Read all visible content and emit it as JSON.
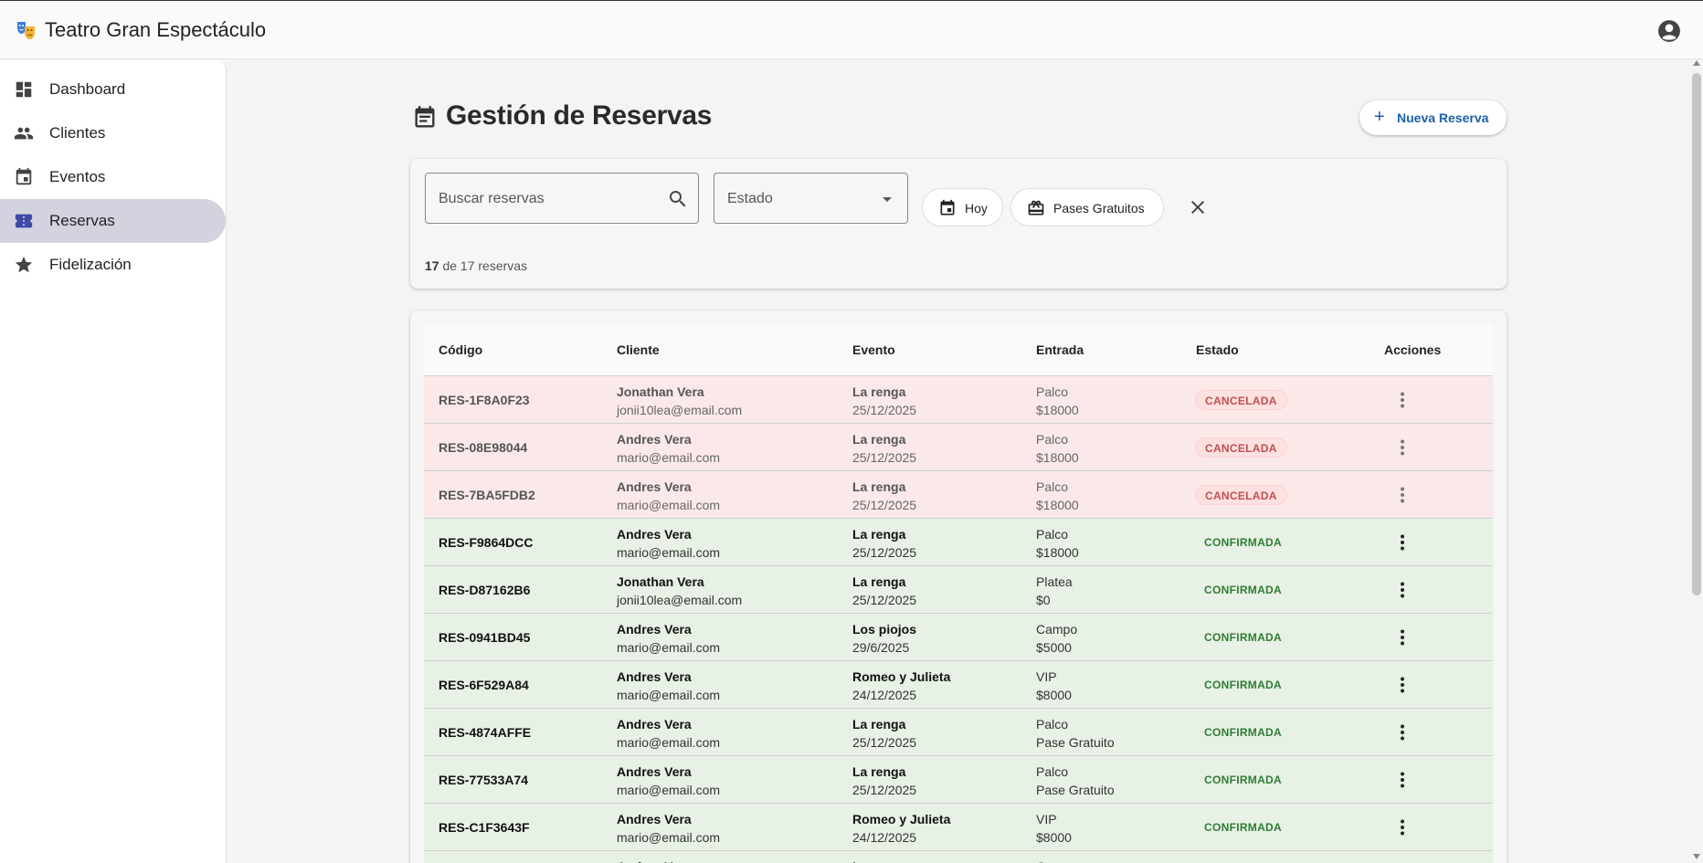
{
  "app": {
    "title": "Teatro Gran Espectáculo"
  },
  "sidebar": {
    "items": [
      {
        "label": "Dashboard",
        "icon": "dashboard-icon",
        "active": false
      },
      {
        "label": "Clientes",
        "icon": "people-icon",
        "active": false
      },
      {
        "label": "Eventos",
        "icon": "calendar-icon",
        "active": false
      },
      {
        "label": "Reservas",
        "icon": "ticket-icon",
        "active": true
      },
      {
        "label": "Fidelización",
        "icon": "star-icon",
        "active": false
      }
    ]
  },
  "page": {
    "title": "Gestión de Reservas",
    "new_button": "Nueva Reserva"
  },
  "filters": {
    "search_placeholder": "Buscar reservas",
    "status_label": "Estado",
    "chip_today": "Hoy",
    "chip_free": "Pases Gratuitos",
    "count_shown": "17",
    "count_rest": "de 17 reservas"
  },
  "table": {
    "headers": [
      "Código",
      "Cliente",
      "Evento",
      "Entrada",
      "Estado",
      "Acciones"
    ],
    "rows": [
      {
        "code": "RES-1F8A0F23",
        "client": "Jonathan Vera",
        "email": "jonii10lea@email.com",
        "event": "La renga",
        "date": "25/12/2025",
        "ticket": "Palco",
        "price": "$18000",
        "status": "CANCELADA"
      },
      {
        "code": "RES-08E98044",
        "client": "Andres Vera",
        "email": "mario@email.com",
        "event": "La renga",
        "date": "25/12/2025",
        "ticket": "Palco",
        "price": "$18000",
        "status": "CANCELADA"
      },
      {
        "code": "RES-7BA5FDB2",
        "client": "Andres Vera",
        "email": "mario@email.com",
        "event": "La renga",
        "date": "25/12/2025",
        "ticket": "Palco",
        "price": "$18000",
        "status": "CANCELADA"
      },
      {
        "code": "RES-F9864DCC",
        "client": "Andres Vera",
        "email": "mario@email.com",
        "event": "La renga",
        "date": "25/12/2025",
        "ticket": "Palco",
        "price": "$18000",
        "status": "CONFIRMADA"
      },
      {
        "code": "RES-D87162B6",
        "client": "Jonathan Vera",
        "email": "jonii10lea@email.com",
        "event": "La renga",
        "date": "25/12/2025",
        "ticket": "Platea",
        "price": "$0",
        "status": "CONFIRMADA"
      },
      {
        "code": "RES-0941BD45",
        "client": "Andres Vera",
        "email": "mario@email.com",
        "event": "Los piojos",
        "date": "29/6/2025",
        "ticket": "Campo",
        "price": "$5000",
        "status": "CONFIRMADA"
      },
      {
        "code": "RES-6F529A84",
        "client": "Andres Vera",
        "email": "mario@email.com",
        "event": "Romeo y Julieta",
        "date": "24/12/2025",
        "ticket": "VIP",
        "price": "$8000",
        "status": "CONFIRMADA"
      },
      {
        "code": "RES-4874AFFE",
        "client": "Andres Vera",
        "email": "mario@email.com",
        "event": "La renga",
        "date": "25/12/2025",
        "ticket": "Palco",
        "price": "Pase Gratuito",
        "status": "CONFIRMADA"
      },
      {
        "code": "RES-77533A74",
        "client": "Andres Vera",
        "email": "mario@email.com",
        "event": "La renga",
        "date": "25/12/2025",
        "ticket": "Palco",
        "price": "Pase Gratuito",
        "status": "CONFIRMADA"
      },
      {
        "code": "RES-C1F3643F",
        "client": "Andres Vera",
        "email": "mario@email.com",
        "event": "Romeo y Julieta",
        "date": "24/12/2025",
        "ticket": "VIP",
        "price": "$8000",
        "status": "CONFIRMADA"
      },
      {
        "code": "",
        "client": "Andres Vera",
        "email": "",
        "event": "La renga",
        "date": "",
        "ticket": "Campo",
        "price": "",
        "status": ""
      }
    ]
  },
  "colors": {
    "accent": "#1b5fa8",
    "nav_active_bg": "#d3d3df",
    "cancel_row": "#fbe9ea",
    "confirm_row": "#e8f1e6",
    "cancel_text": "#c0504f",
    "confirm_text": "#2e7d32"
  }
}
